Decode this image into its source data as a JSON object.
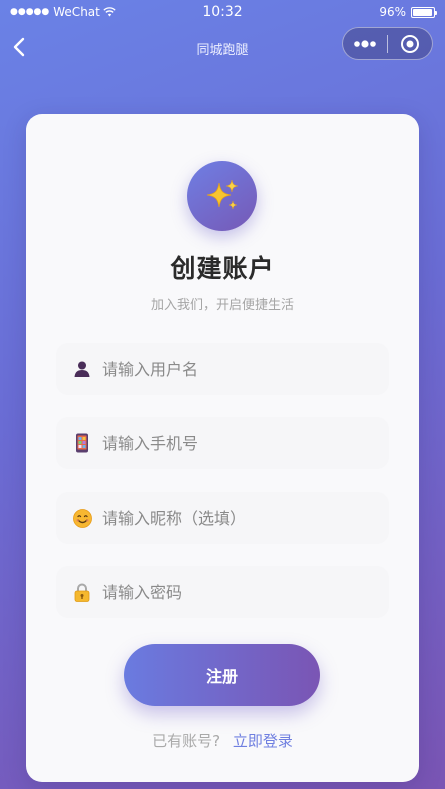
{
  "status_bar": {
    "signal": "●●●●●",
    "carrier": "WeChat",
    "time": "10:32",
    "battery": "96%",
    "battery_level": 0.96
  },
  "nav": {
    "title": "同城跑腿",
    "back_icon": "chevron-left-icon",
    "more_icon": "more-dots-icon",
    "close_icon": "target-circle-icon"
  },
  "header": {
    "logo_icon": "sparkles-icon",
    "title": "创建账户",
    "subtitle": "加入我们，开启便捷生活"
  },
  "form": {
    "fields": [
      {
        "icon": "person-icon",
        "placeholder": "请输入用户名"
      },
      {
        "icon": "phone-icon",
        "placeholder": "请输入手机号"
      },
      {
        "icon": "smile-icon",
        "placeholder": "请输入昵称（选填）"
      },
      {
        "icon": "lock-icon",
        "placeholder": "请输入密码"
      }
    ],
    "submit_label": "注册",
    "login_prompt": "已有账号?",
    "login_link": "立即登录"
  },
  "colors": {
    "gradient_start": "#6a82e6",
    "gradient_end": "#7a55b4",
    "link": "#6f7fe0",
    "title": "#2b2b2b"
  }
}
